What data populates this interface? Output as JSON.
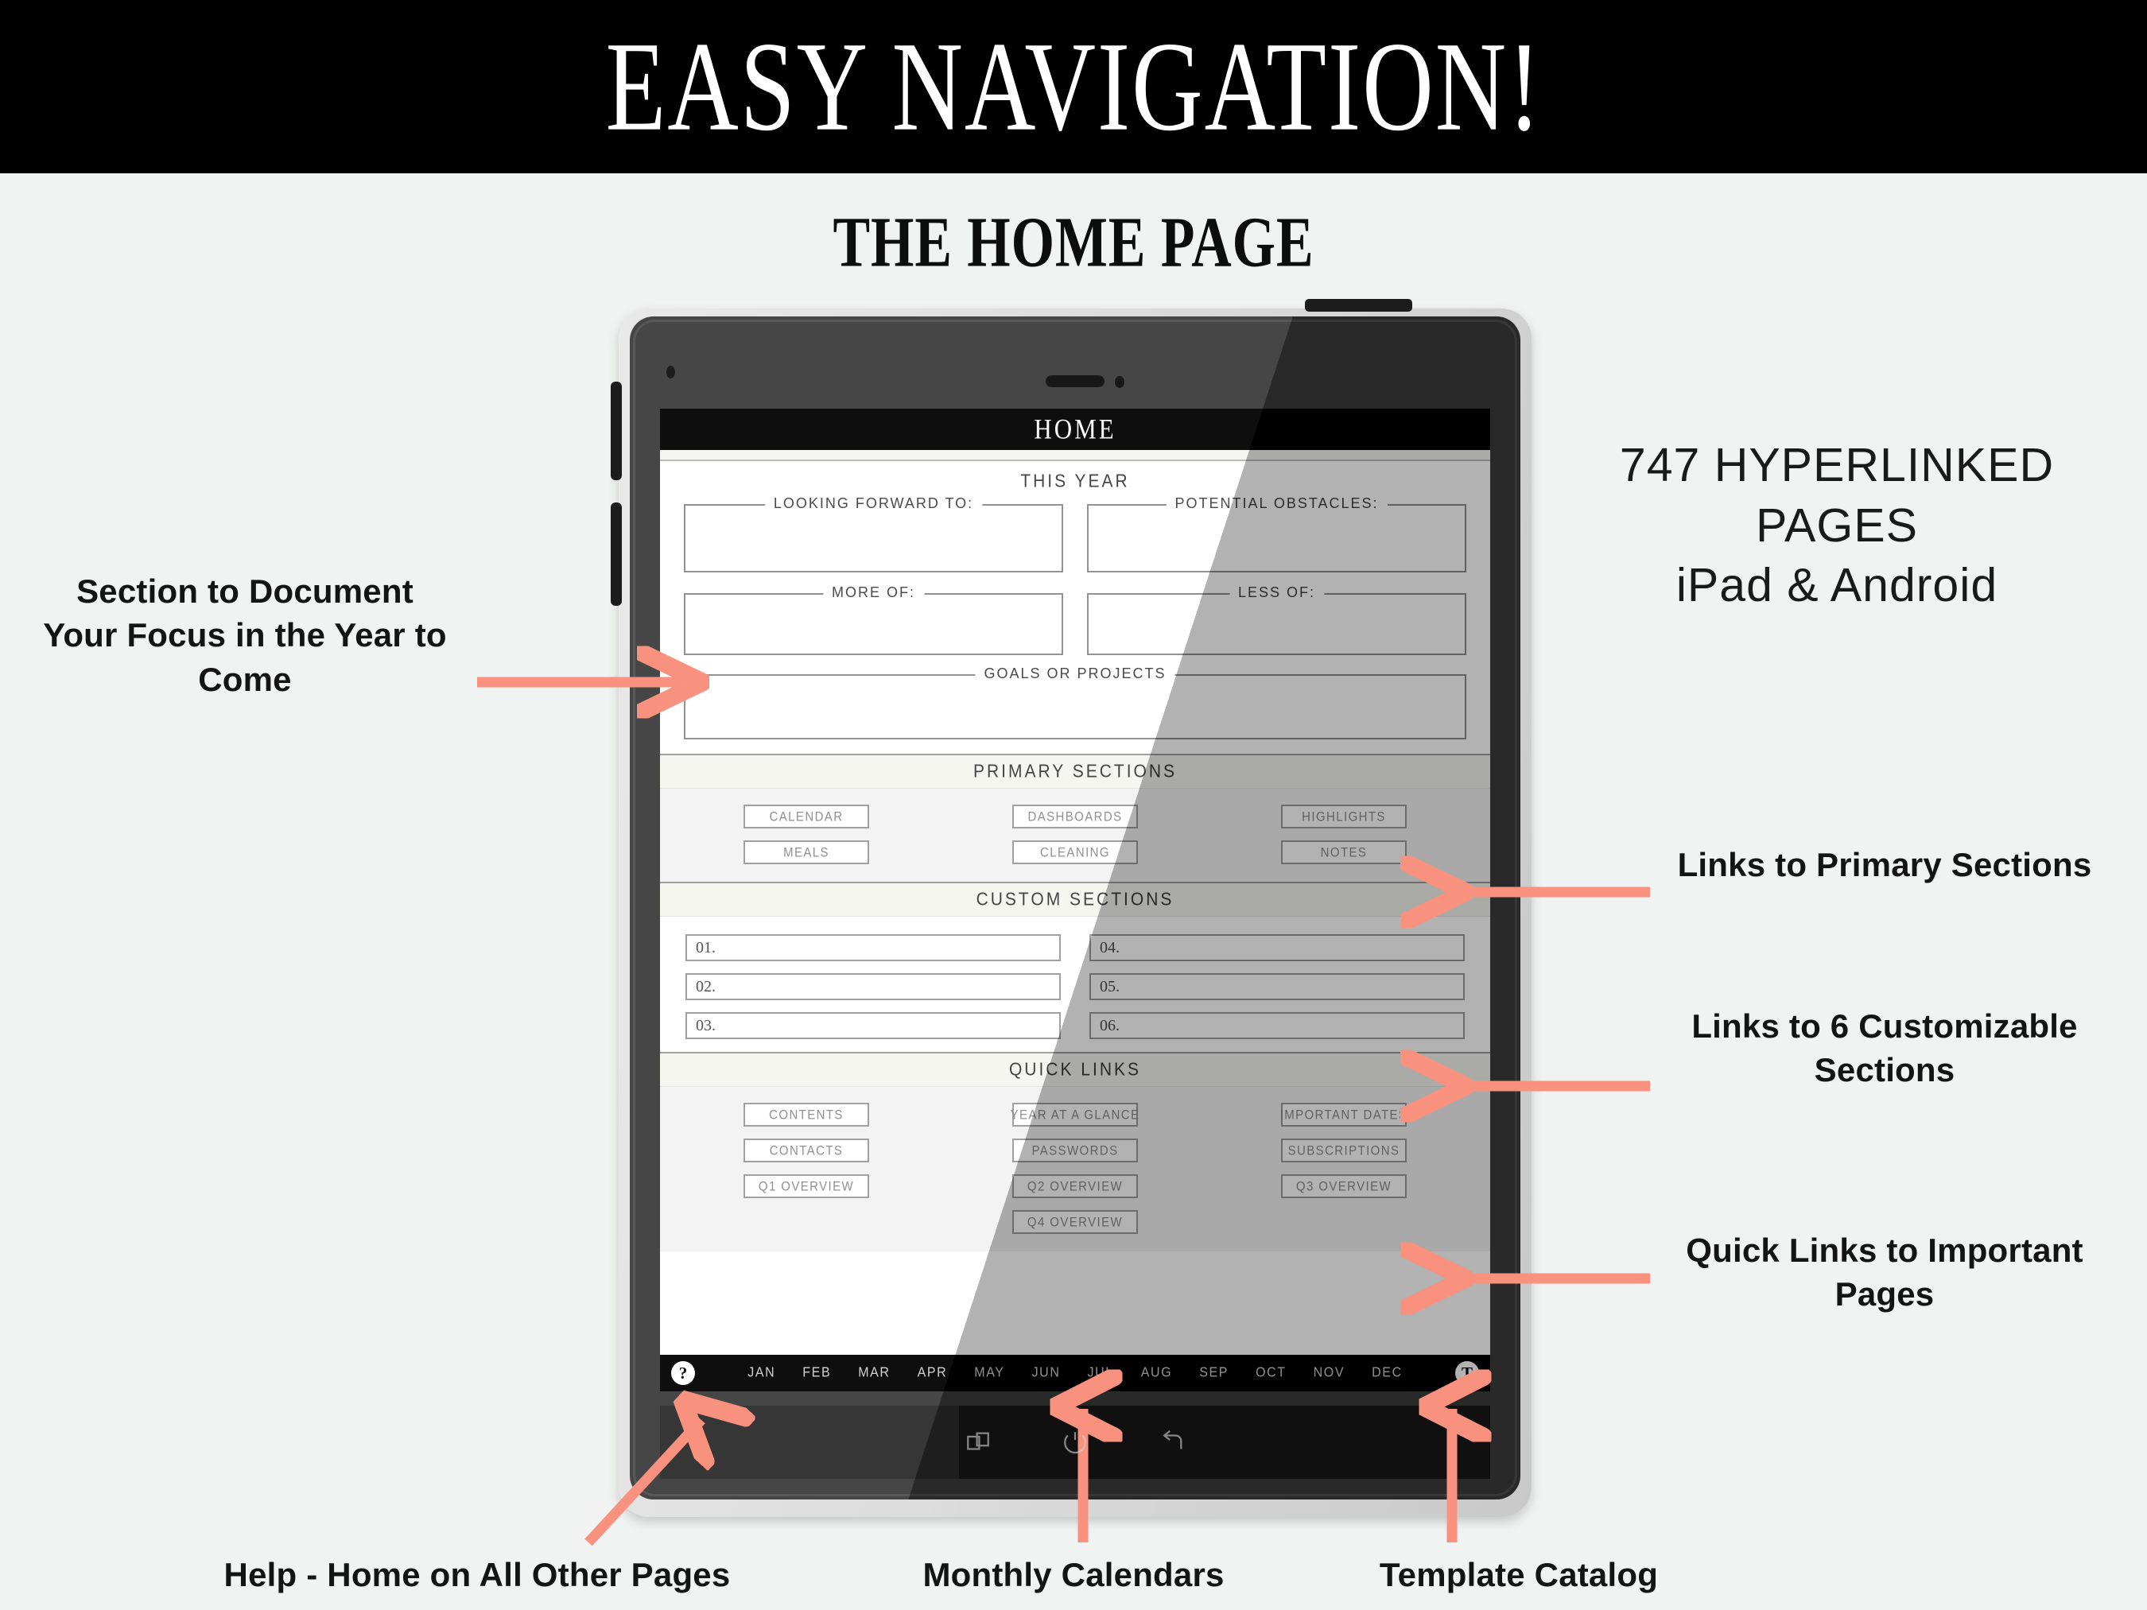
{
  "banner": {
    "title": "EASY NAVIGATION!"
  },
  "subtitle": "THE HOME PAGE",
  "accent_color": "#F8917E",
  "device": {
    "type": "android-tablet",
    "screen": {
      "header_title": "HOME",
      "this_year": {
        "section_title": "THIS YEAR",
        "fields": [
          {
            "label": "LOOKING FORWARD TO:"
          },
          {
            "label": "POTENTIAL OBSTACLES:"
          },
          {
            "label": "MORE OF:"
          },
          {
            "label": "LESS OF:"
          },
          {
            "label": "GOALS OR PROJECTS"
          }
        ]
      },
      "primary_sections": {
        "section_title": "PRIMARY SECTIONS",
        "links": [
          "CALENDAR",
          "DASHBOARDS",
          "HIGHLIGHTS",
          "MEALS",
          "CLEANING",
          "NOTES"
        ]
      },
      "custom_sections": {
        "section_title": "CUSTOM SECTIONS",
        "fields": [
          "01.",
          "02.",
          "03.",
          "04.",
          "05.",
          "06."
        ]
      },
      "quick_links": {
        "section_title": "QUICK LINKS",
        "links": [
          "CONTENTS",
          "YEAR AT A GLANCE",
          "IMPORTANT DATES",
          "CONTACTS",
          "PASSWORDS",
          "SUBSCRIPTIONS",
          "Q1 OVERVIEW",
          "Q2 OVERVIEW",
          "Q3 OVERVIEW"
        ],
        "center_link": "Q4 OVERVIEW"
      },
      "planner_nav": {
        "help_icon_label": "?",
        "template_icon_label": "T",
        "months": [
          "JAN",
          "FEB",
          "MAR",
          "APR",
          "MAY",
          "JUN",
          "JUL",
          "AUG",
          "SEP",
          "OCT",
          "NOV",
          "DEC"
        ]
      }
    }
  },
  "annotations": {
    "left": "Section to Document Your Focus in the Year to Come",
    "right_headline": "747 HYPERLINKED PAGES\niPad & Android",
    "right_headline_line1": "747 HYPERLINKED",
    "right_headline_line2": "PAGES",
    "right_headline_line3": "iPad & Android",
    "right_1": "Links to Primary Sections",
    "right_2": "Links to 6 Customizable Sections",
    "right_3": "Quick Links to Important Pages",
    "bottom_1": "Help - Home on All Other Pages",
    "bottom_2": "Monthly Calendars",
    "bottom_3": "Template Catalog"
  }
}
